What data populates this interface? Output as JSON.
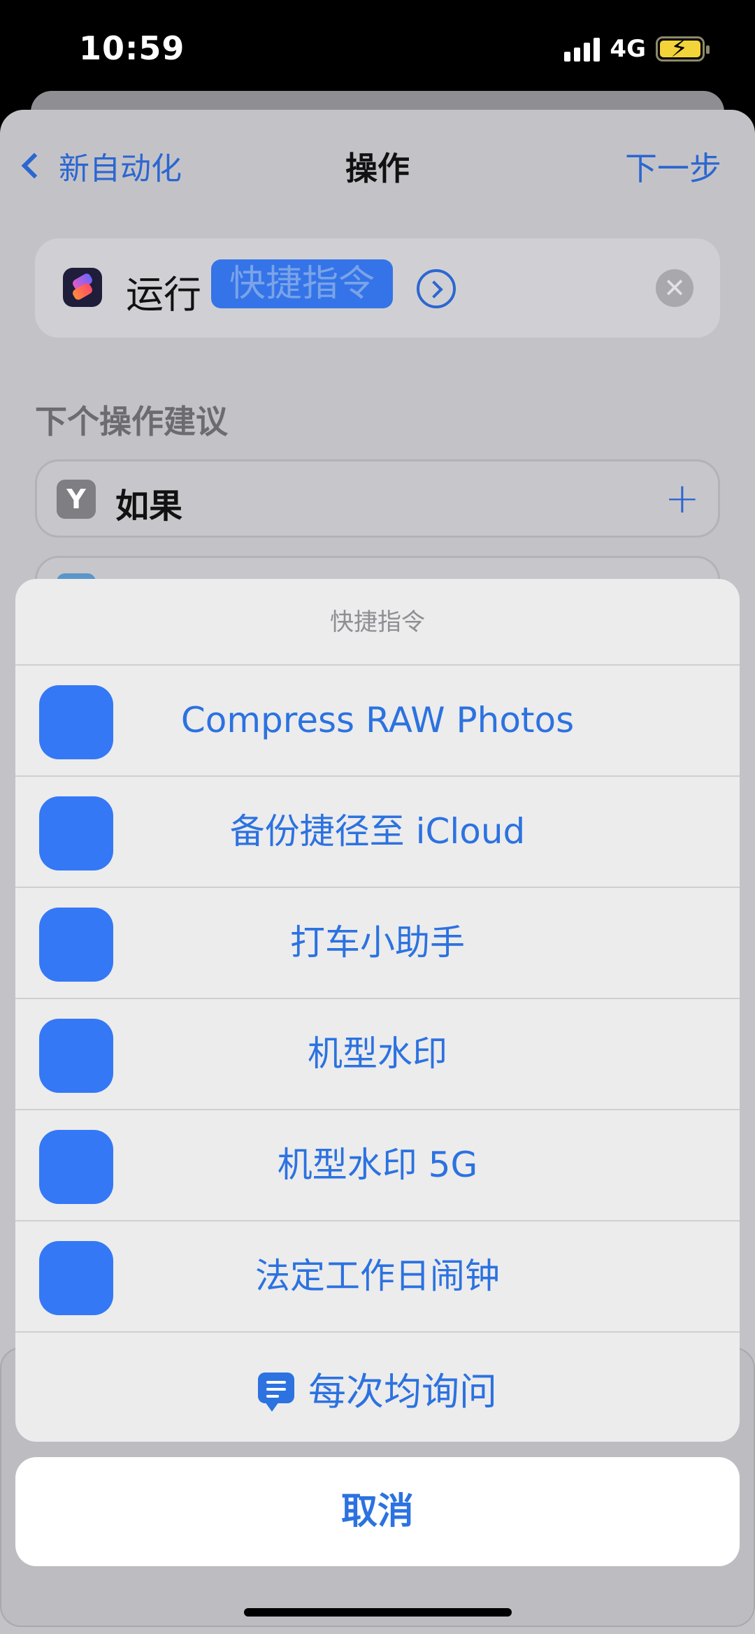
{
  "status_bar": {
    "time": "10:59",
    "network": "4G"
  },
  "nav": {
    "back_label": "新自动化",
    "title": "操作",
    "next_label": "下一步"
  },
  "action": {
    "run_label": "运行",
    "param_label": "快捷指令"
  },
  "suggestions": {
    "heading": "下个操作建议",
    "if_label": "如果"
  },
  "action_sheet": {
    "title": "快捷指令",
    "options": [
      "Compress RAW Photos",
      "备份捷径至 iCloud",
      "打车小助手",
      "机型水印",
      "机型水印 5G",
      "法定工作日闹钟"
    ],
    "ask_each_time": "每次均询问",
    "cancel_label": "取消"
  },
  "colors": {
    "accent": "#2c72e0",
    "shortcut_icon": "#3478f6",
    "sheet_bg": "#ececed",
    "dim_bg": "#c3c3c7"
  },
  "icons": [
    "back-chevron-icon",
    "shortcuts-app-icon",
    "expand-arrow-icon",
    "clear-icon",
    "if-branch-icon",
    "plus-icon",
    "chat-bubble-icon"
  ]
}
